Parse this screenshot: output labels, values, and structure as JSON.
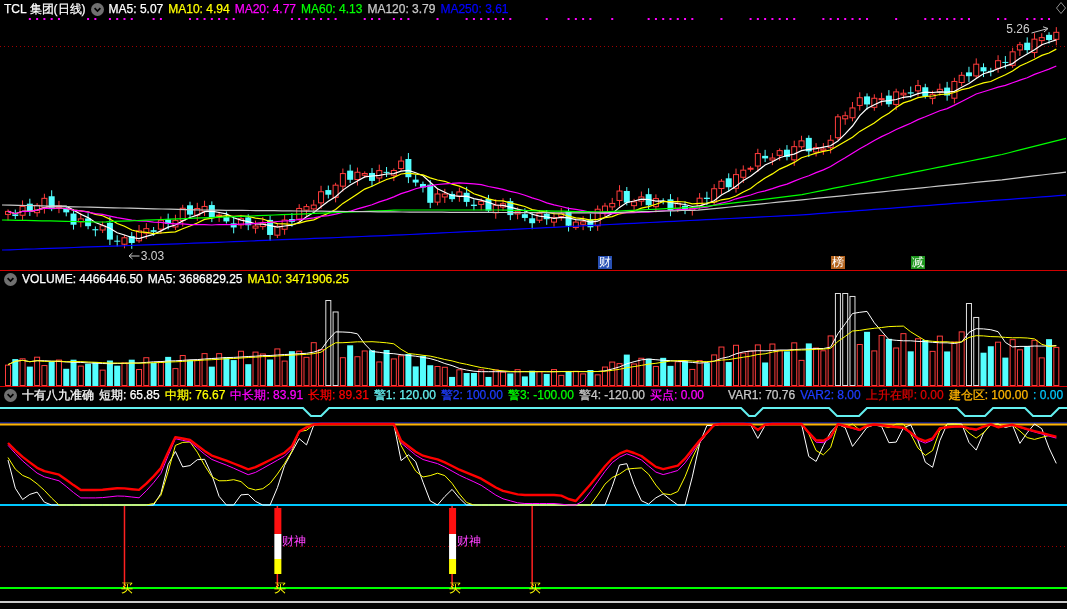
{
  "price_pane": {
    "title": "TCL 集团(日线)",
    "indicators": [
      {
        "label": "MA5: 5.07",
        "color": "#ffffff"
      },
      {
        "label": "MA10: 4.94",
        "color": "#ffff00"
      },
      {
        "label": "MA20: 4.77",
        "color": "#ff00ff"
      },
      {
        "label": "MA60: 4.13",
        "color": "#00ff00"
      },
      {
        "label": "MA120: 3.79",
        "color": "#c8c8c8"
      },
      {
        "label": "MA250: 3.61",
        "color": "#0000ff"
      }
    ],
    "high_label": "5.26",
    "low_label": "3.03",
    "event_tags": [
      {
        "text": "财",
        "color": "#2850b4"
      },
      {
        "text": "榜",
        "color": "#b4641e"
      },
      {
        "text": "减",
        "color": "#1e961e"
      }
    ]
  },
  "volume_pane": {
    "indicators": [
      {
        "label": "VOLUME: 4466446.50",
        "color": "#ffffff"
      },
      {
        "label": "MA5: 3686829.25",
        "color": "#ffffff"
      },
      {
        "label": "MA10: 3471906.25",
        "color": "#ffff00"
      }
    ]
  },
  "signal_pane": {
    "title": "十有八九准确",
    "indicators": [
      {
        "label": "短期: 65.85",
        "color": "#ffffff"
      },
      {
        "label": "中期: 76.67",
        "color": "#ffff00"
      },
      {
        "label": "中长期: 83.91",
        "color": "#ff00ff"
      },
      {
        "label": "长期: 89.31",
        "color": "#ff0000"
      },
      {
        "label": "警1: 120.00",
        "color": "#64f0f0"
      },
      {
        "label": "警2: 100.00",
        "color": "#1e3cff"
      },
      {
        "label": "警3: -100.00",
        "color": "#00ff00"
      },
      {
        "label": "警4: -120.00",
        "color": "#c8c8c8"
      },
      {
        "label": "买点: 0.00",
        "color": "#ff00ff"
      }
    ],
    "var_indicators": [
      {
        "label": "VAR1: 70.76",
        "color": "#c8c8c8"
      },
      {
        "label": "VAR2: 8.00",
        "color": "#1e3cff"
      },
      {
        "label": "上升在即: 0.00",
        "color": "#e00000"
      },
      {
        "label": "建仓区: 100.00",
        "color": "#ffb400"
      },
      {
        "label": ": 0.00",
        "color": "#00c8ff"
      }
    ],
    "signals": [
      {
        "kind": "buy",
        "label": "买"
      },
      {
        "kind": "strong_buy",
        "label": "买",
        "tag": "财神"
      },
      {
        "kind": "strong_buy",
        "label": "买",
        "tag": "财神"
      },
      {
        "kind": "buy",
        "label": "买"
      }
    ]
  }
}
